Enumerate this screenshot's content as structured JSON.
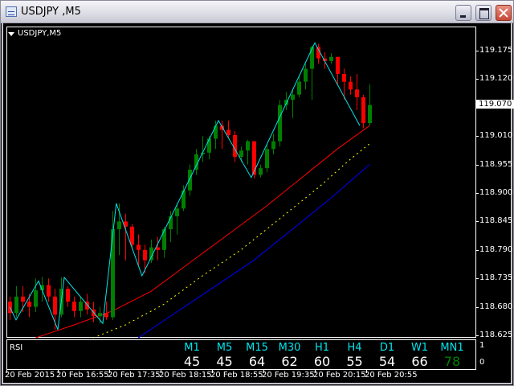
{
  "window": {
    "title": "USDJPY ,M5"
  },
  "chart": {
    "symbol_label": "USDJPY,M5",
    "current_price": "119.070",
    "price_axis": [
      "119.175",
      "119.120",
      "119.010",
      "118.955",
      "118.900",
      "118.845",
      "118.790",
      "118.735",
      "118.680",
      "118.625"
    ],
    "price_min": 118.625,
    "price_max": 119.175,
    "time_axis": [
      "20 Feb 2015",
      "20 Feb 16:55",
      "20 Feb 17:35",
      "20 Feb 18:15",
      "20 Feb 18:55",
      "20 Feb 19:35",
      "20 Feb 20:15",
      "20 Feb 20:55"
    ],
    "colors": {
      "bull": "#008000",
      "bear": "#ff0000",
      "zigzag": "#00e5ee",
      "ma_fast": "#ff0000",
      "ma_mid": "#ffff00",
      "ma_slow": "#0000ff"
    },
    "candles": [
      [
        118.69,
        118.7,
        118.655,
        118.668
      ],
      [
        118.668,
        118.72,
        118.66,
        118.7
      ],
      [
        118.7,
        118.72,
        118.67,
        118.69
      ],
      [
        118.69,
        118.705,
        118.66,
        118.68
      ],
      [
        118.68,
        118.735,
        118.67,
        118.712
      ],
      [
        118.712,
        118.738,
        118.69,
        118.722
      ],
      [
        118.722,
        118.735,
        118.69,
        118.7
      ],
      [
        118.7,
        118.715,
        118.636,
        118.665
      ],
      [
        118.665,
        118.737,
        118.66,
        118.715
      ],
      [
        118.715,
        118.72,
        118.68,
        118.69
      ],
      [
        118.69,
        118.7,
        118.66,
        118.672
      ],
      [
        118.672,
        118.7,
        118.66,
        118.69
      ],
      [
        118.69,
        118.705,
        118.665,
        118.675
      ],
      [
        118.675,
        118.69,
        118.65,
        118.662
      ],
      [
        118.662,
        118.68,
        118.648,
        118.668
      ],
      [
        118.668,
        118.69,
        118.655,
        118.66
      ],
      [
        118.66,
        118.865,
        118.655,
        118.83
      ],
      [
        118.83,
        118.88,
        118.78,
        118.845
      ],
      [
        118.845,
        118.86,
        118.77,
        118.835
      ],
      [
        118.835,
        118.84,
        118.79,
        118.8
      ],
      [
        118.8,
        118.82,
        118.76,
        118.79
      ],
      [
        118.79,
        118.8,
        118.745,
        118.77
      ],
      [
        118.77,
        118.81,
        118.765,
        118.795
      ],
      [
        118.795,
        118.815,
        118.77,
        118.79
      ],
      [
        118.79,
        118.835,
        118.775,
        118.83
      ],
      [
        118.83,
        118.865,
        118.805,
        118.855
      ],
      [
        118.855,
        118.88,
        118.82,
        118.87
      ],
      [
        118.87,
        118.915,
        118.865,
        118.905
      ],
      [
        118.905,
        118.955,
        118.895,
        118.945
      ],
      [
        118.945,
        118.985,
        118.935,
        118.975
      ],
      [
        118.975,
        119.01,
        118.96,
        118.978
      ],
      [
        118.978,
        119.01,
        118.965,
        119.005
      ],
      [
        119.005,
        119.04,
        118.985,
        119.03
      ],
      [
        119.03,
        119.04,
        118.985,
        119.022
      ],
      [
        119.022,
        119.04,
        119.005,
        119.012
      ],
      [
        119.012,
        119.02,
        118.96,
        118.97
      ],
      [
        118.97,
        118.99,
        118.96,
        118.982
      ],
      [
        118.982,
        119.003,
        118.955,
        119.0
      ],
      [
        119.0,
        119.0,
        118.928,
        118.935
      ],
      [
        118.935,
        118.955,
        118.93,
        118.948
      ],
      [
        118.948,
        118.995,
        118.94,
        118.985
      ],
      [
        118.985,
        119.015,
        118.975,
        119.0
      ],
      [
        119.0,
        119.08,
        118.99,
        119.07
      ],
      [
        119.07,
        119.095,
        119.06,
        119.08
      ],
      [
        119.08,
        119.1,
        119.045,
        119.09
      ],
      [
        119.09,
        119.125,
        119.085,
        119.115
      ],
      [
        119.115,
        119.15,
        119.1,
        119.14
      ],
      [
        119.14,
        119.185,
        119.08,
        119.182
      ],
      [
        119.182,
        119.188,
        119.15,
        119.16
      ],
      [
        119.16,
        119.172,
        119.14,
        119.155
      ],
      [
        119.155,
        119.17,
        119.15,
        119.163
      ],
      [
        119.163,
        119.163,
        119.11,
        119.13
      ],
      [
        119.13,
        119.14,
        119.08,
        119.115
      ],
      [
        119.115,
        119.125,
        119.09,
        119.1
      ],
      [
        119.1,
        119.13,
        119.06,
        119.085
      ],
      [
        119.085,
        119.09,
        119.025,
        119.035
      ],
      [
        119.035,
        119.11,
        119.03,
        119.07
      ]
    ],
    "zigzag": [
      [
        0,
        118.68
      ],
      [
        1,
        118.655
      ],
      [
        4.5,
        118.73
      ],
      [
        7.5,
        118.636
      ],
      [
        8.5,
        118.737
      ],
      [
        14.5,
        118.648
      ],
      [
        16.6,
        118.88
      ],
      [
        20.6,
        118.74
      ],
      [
        32.5,
        119.04
      ],
      [
        37.6,
        118.93
      ],
      [
        47.5,
        119.19
      ],
      [
        54.5,
        119.03
      ]
    ],
    "ma_fast": [
      [
        4,
        118.62
      ],
      [
        10,
        118.645
      ],
      [
        16,
        118.672
      ],
      [
        22,
        118.71
      ],
      [
        28,
        118.765
      ],
      [
        34,
        118.82
      ],
      [
        40,
        118.875
      ],
      [
        46,
        118.935
      ],
      [
        51,
        118.985
      ],
      [
        56,
        119.03
      ]
    ],
    "ma_mid": [
      [
        13,
        118.62
      ],
      [
        18,
        118.645
      ],
      [
        24,
        118.685
      ],
      [
        30,
        118.74
      ],
      [
        36,
        118.79
      ],
      [
        42,
        118.85
      ],
      [
        48,
        118.91
      ],
      [
        53,
        118.965
      ],
      [
        56,
        118.995
      ]
    ],
    "ma_slow": [
      [
        20,
        118.62
      ],
      [
        26,
        118.67
      ],
      [
        32,
        118.72
      ],
      [
        38,
        118.77
      ],
      [
        44,
        118.83
      ],
      [
        50,
        118.89
      ],
      [
        56,
        118.955
      ]
    ]
  },
  "rsi_panel": {
    "label": "RSI",
    "scale_top": "1",
    "scale_bottom": "0",
    "timeframes": [
      {
        "tf": "M1",
        "value": "45",
        "color": "#ffffff"
      },
      {
        "tf": "M5",
        "value": "45",
        "color": "#ffffff"
      },
      {
        "tf": "M15",
        "value": "64",
        "color": "#ffffff"
      },
      {
        "tf": "M30",
        "value": "62",
        "color": "#ffffff"
      },
      {
        "tf": "H1",
        "value": "60",
        "color": "#ffffff"
      },
      {
        "tf": "H4",
        "value": "55",
        "color": "#ffffff"
      },
      {
        "tf": "D1",
        "value": "54",
        "color": "#ffffff"
      },
      {
        "tf": "W1",
        "value": "66",
        "color": "#ffffff"
      },
      {
        "tf": "MN1",
        "value": "78",
        "color": "#008000"
      }
    ]
  }
}
